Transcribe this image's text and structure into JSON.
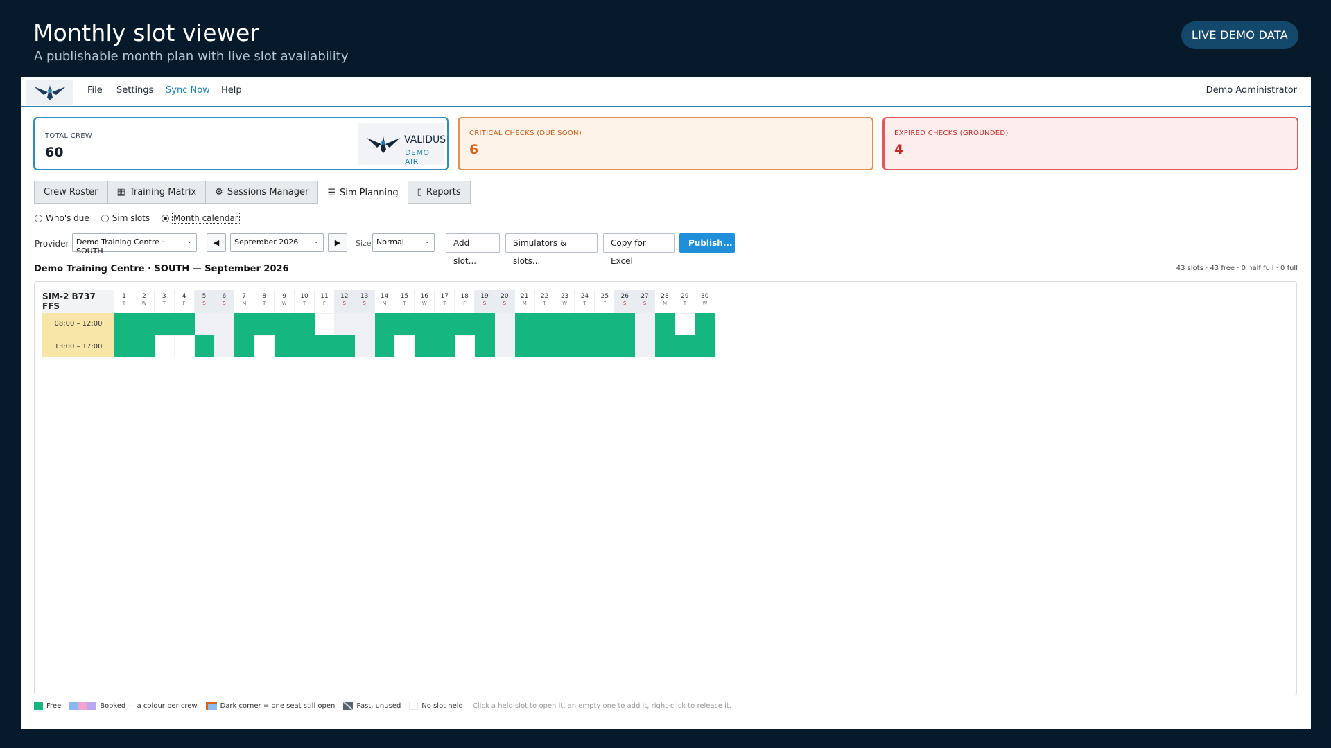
{
  "header": {
    "title": "Monthly slot viewer",
    "subtitle": "A publishable month plan with live slot availability",
    "badge": "LIVE DEMO DATA"
  },
  "menu": {
    "items": [
      "File",
      "Settings",
      "Sync Now",
      "Help"
    ],
    "user": "Demo Administrator"
  },
  "stats": {
    "total_crew": {
      "label": "TOTAL CREW",
      "value": "60"
    },
    "critical": {
      "label": "CRITICAL CHECKS (DUE SOON)",
      "value": "6"
    },
    "expired": {
      "label": "EXPIRED CHECKS (GROUNDED)",
      "value": "4"
    },
    "brand_name": "VALIDUS",
    "brand_sub": "DEMO AIR"
  },
  "tabs": [
    "Crew Roster",
    "Training Matrix",
    "Sessions Manager",
    "Sim Planning",
    "Reports"
  ],
  "active_tab": "Sim Planning",
  "view_modes": {
    "options": [
      "Who's due",
      "Sim slots",
      "Month calendar"
    ],
    "selected": "Month calendar"
  },
  "toolbar": {
    "provider_label": "Provider",
    "provider_value": "Demo Training Centre · SOUTH",
    "month_value": "September 2026",
    "size_label": "Size",
    "size_value": "Normal",
    "add_slot": "Add slot...",
    "simulators": "Simulators & slots...",
    "copy_excel": "Copy for Excel",
    "publish": "Publish..."
  },
  "calendar": {
    "title": "Demo Training Centre · SOUTH — September 2026",
    "summary": "43 slots · 43 free · 0 half full · 0 full",
    "simulator": "SIM-2 B737 FFS",
    "days": [
      {
        "d": "1",
        "w": "T"
      },
      {
        "d": "2",
        "w": "W"
      },
      {
        "d": "3",
        "w": "T"
      },
      {
        "d": "4",
        "w": "F"
      },
      {
        "d": "5",
        "w": "S"
      },
      {
        "d": "6",
        "w": "S"
      },
      {
        "d": "7",
        "w": "M"
      },
      {
        "d": "8",
        "w": "T"
      },
      {
        "d": "9",
        "w": "W"
      },
      {
        "d": "10",
        "w": "T"
      },
      {
        "d": "11",
        "w": "F"
      },
      {
        "d": "12",
        "w": "S"
      },
      {
        "d": "13",
        "w": "S"
      },
      {
        "d": "14",
        "w": "M"
      },
      {
        "d": "15",
        "w": "T"
      },
      {
        "d": "16",
        "w": "W"
      },
      {
        "d": "17",
        "w": "T"
      },
      {
        "d": "18",
        "w": "F"
      },
      {
        "d": "19",
        "w": "S"
      },
      {
        "d": "20",
        "w": "S"
      },
      {
        "d": "21",
        "w": "M"
      },
      {
        "d": "22",
        "w": "T"
      },
      {
        "d": "23",
        "w": "W"
      },
      {
        "d": "24",
        "w": "T"
      },
      {
        "d": "25",
        "w": "F"
      },
      {
        "d": "26",
        "w": "S"
      },
      {
        "d": "27",
        "w": "S"
      },
      {
        "d": "28",
        "w": "M"
      },
      {
        "d": "29",
        "w": "T"
      },
      {
        "d": "30",
        "w": "W"
      }
    ],
    "slots": [
      {
        "label": "08:00 – 12:00",
        "cells": "FFFFwwFFFFEwwFFFFFFwFFFFFFwFEF"
      },
      {
        "label": "13:00 – 17:00",
        "cells": "FFEEFwFEFFFFwFEFFEFwFFFFFFwFFF"
      }
    ]
  },
  "legend": {
    "free": "Free",
    "booked": "Booked — a colour per crew",
    "dark_corner": "Dark corner = one seat still open",
    "past": "Past, unused",
    "no_slot": "No slot held",
    "hint": "Click a held slot to open it, an empty one to add it, right-click to release it.",
    "colors": {
      "free": "#15b67f",
      "booked1": "#8ab8f0",
      "booked2": "#f2a3cf",
      "booked3": "#b9a6f0"
    }
  }
}
